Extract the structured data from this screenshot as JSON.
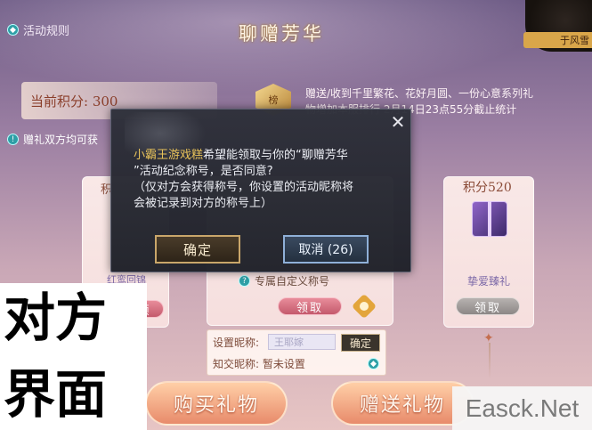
{
  "header": {
    "rules_link": "活动规则",
    "title": "聊赠芳华",
    "corner_badge": "于风雪"
  },
  "points": {
    "label": "当前积分: 300"
  },
  "info": {
    "emblem": "榜",
    "line1": "赠送/收到千里繁花、花好月圆、一份心意系列礼",
    "line2": "物增加本服排行      2月14日23点55分截止统计"
  },
  "tip": {
    "text": "赠礼双方均可获"
  },
  "cards": {
    "left": {
      "title": "积",
      "name": "红鸾回锦",
      "claim_label": "领"
    },
    "middle": {
      "label": "专属自定义称号",
      "claim_label": "领取"
    },
    "right": {
      "title": "积分520",
      "name": "挚爱臻礼",
      "claim_label": "领取"
    }
  },
  "nickname": {
    "set_label": "设置昵称:",
    "input_value": "王耶嫁",
    "confirm_label": "确定",
    "friend_label": "知交昵称: 暂未设置"
  },
  "bottom": {
    "buy_label": "购买礼物",
    "gift_label": "赠送礼物"
  },
  "modal": {
    "requester": "小霸王游戏糕",
    "message_rest_line1": "希望能领取与你的“聊赠芳华",
    "message_line2": "”活动纪念称号，是否同意?",
    "message_line3": "（仅对方会获得称号，你设置的活动昵称将",
    "message_line4": "会被记录到对方的称号上）",
    "ok_label": "确定",
    "cancel_label": "取消 (26)",
    "close_symbol": "✕"
  },
  "overlay": {
    "line1": "对方",
    "line2": "界面"
  },
  "watermark": "Easck.Net",
  "colors": {
    "accent_gold": "#e9c35a",
    "claim_pink": "#c45a6c",
    "modal_bg": "#2e303a"
  }
}
